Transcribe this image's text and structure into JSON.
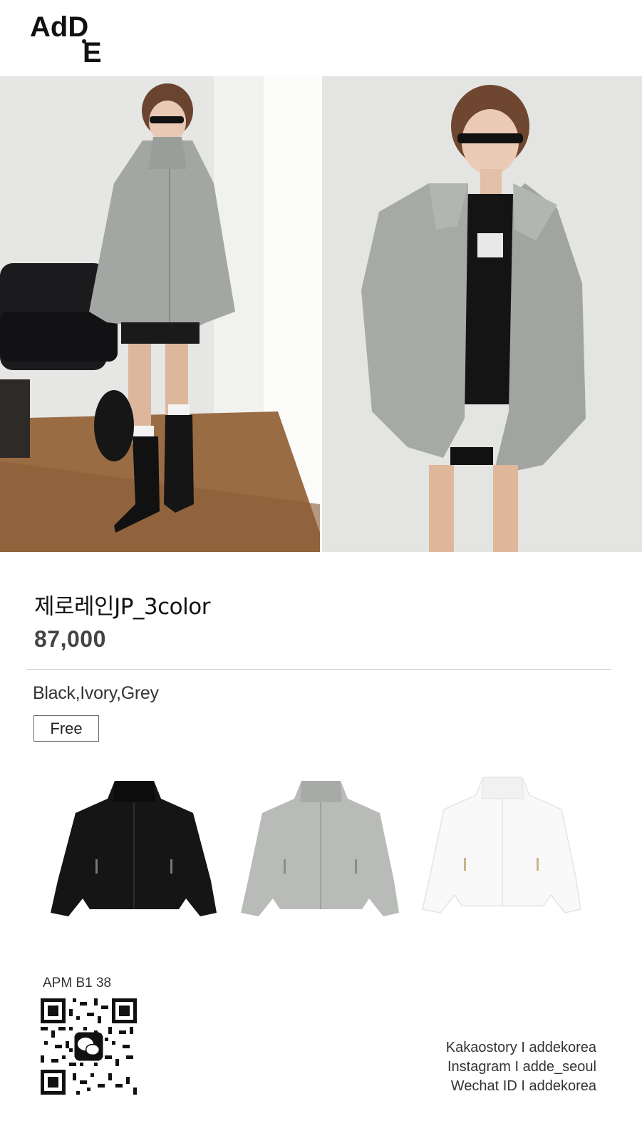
{
  "brand": {
    "logo_text": "AdDE",
    "logo_top": "AdD",
    "logo_bottom": "E"
  },
  "hero": {
    "left_photo_icon": "model-full-body-photo",
    "right_photo_icon": "model-upper-body-photo"
  },
  "product": {
    "title": "제로레인JP_3color",
    "price": "87,000",
    "colors": "Black,Ivory,Grey",
    "size": "Free"
  },
  "swatches": [
    {
      "name": "Black",
      "color": "#151515"
    },
    {
      "name": "Grey",
      "color": "#b9bbb8"
    },
    {
      "name": "Ivory",
      "color": "#f9f9f9"
    }
  ],
  "footer": {
    "location": "APM B1 38",
    "qr_icon": "wechat-qr-code",
    "kakao": "Kakaostory I addekorea",
    "instagram": "Instagram I adde_seoul",
    "wechat": "Wechat ID I addekorea"
  }
}
